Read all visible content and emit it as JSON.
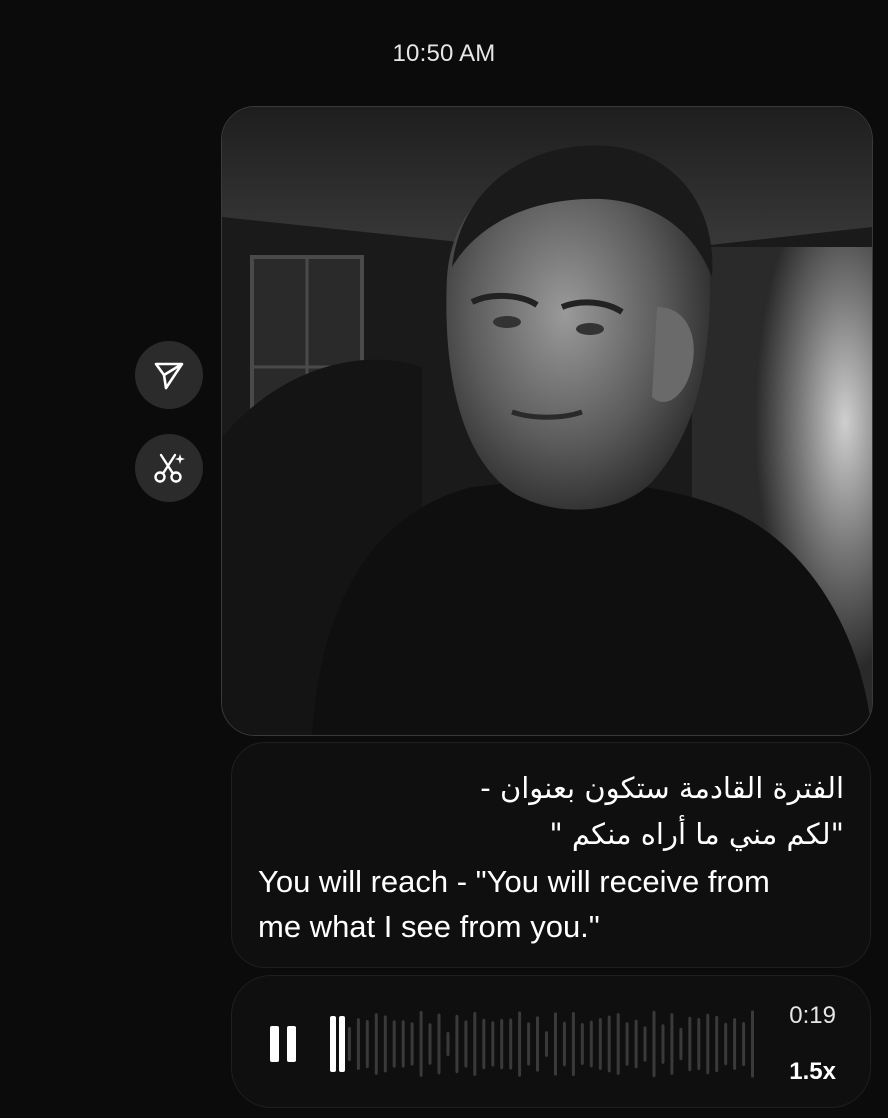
{
  "header": {
    "timestamp": "10:50 AM"
  },
  "message": {
    "photo_description_icon": "image",
    "actions": {
      "share_icon": "send-icon",
      "remix_icon": "scissors-sparkle-icon"
    },
    "caption": {
      "arabic_line1": "الفترة القادمة ستكون بعنوان -",
      "arabic_line2": "\"لكم مني ما أراه منكم \"",
      "english_line1": "You will reach - \"You will receive from",
      "english_line2": "me what I see from you.\""
    },
    "audio": {
      "state_icon": "pause-icon",
      "duration": "0:19",
      "speed": "1.5x",
      "progress": 0.05
    }
  },
  "colors": {
    "background": "#0b0b0b",
    "bubble": "#0f0f0f",
    "button": "#2b2b2b",
    "text": "#ffffff"
  }
}
